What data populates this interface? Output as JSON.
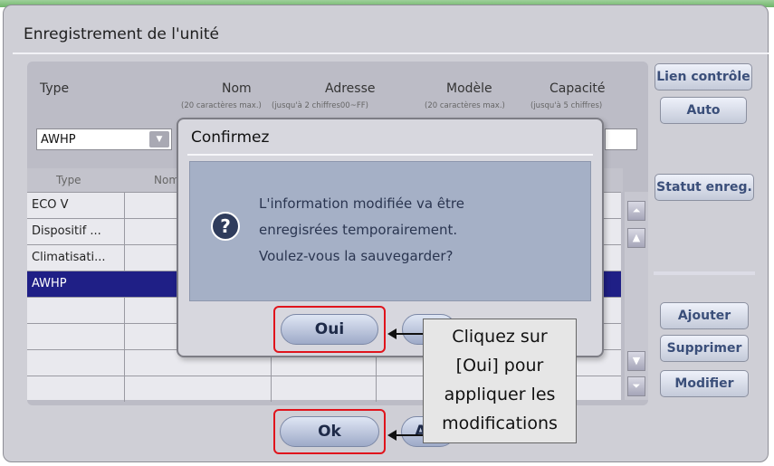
{
  "window": {
    "title": "Enregistrement de l'unité"
  },
  "form": {
    "headers": [
      "Type",
      "Nom",
      "Adresse",
      "Modèle",
      "Capacité"
    ],
    "subheaders": {
      "nom": "(20 caractères max.)",
      "adresse": "(jusqu'à 2 chiffres00~FF)",
      "modele": "(20 caractères max.)",
      "capacite": "(jusqu'à 5 chiffres)"
    },
    "type_value": "AWHP"
  },
  "grid": {
    "columns": [
      "Type",
      "Nom"
    ],
    "rows": [
      "ECO V",
      "Dispositif ...",
      "Climatisati...",
      "AWHP",
      "",
      "",
      "",
      ""
    ],
    "selected_index": 3
  },
  "side_buttons": {
    "lien": "Lien contrôle",
    "auto": "Auto",
    "statut": "Statut enreg.",
    "ajouter": "Ajouter",
    "supprimer": "Supprimer",
    "modifier": "Modifier"
  },
  "bottom_buttons": {
    "ok": "Ok",
    "annuler_partial": "A"
  },
  "dialog": {
    "title": "Confirmez",
    "message_lines": [
      "L'information modifiée va être",
      "enregisrées temporairement.",
      "Voulez-vous la sauvegarder?"
    ],
    "oui": "Oui",
    "icon": "question-icon"
  },
  "callout": {
    "lines": [
      "Cliquez sur",
      "[Oui] pour",
      "appliquer les",
      "modifications"
    ]
  },
  "colors": {
    "selected_row": "#1f1f86",
    "highlight": "#e0141c",
    "dialog_body": "#a5b0c6"
  }
}
